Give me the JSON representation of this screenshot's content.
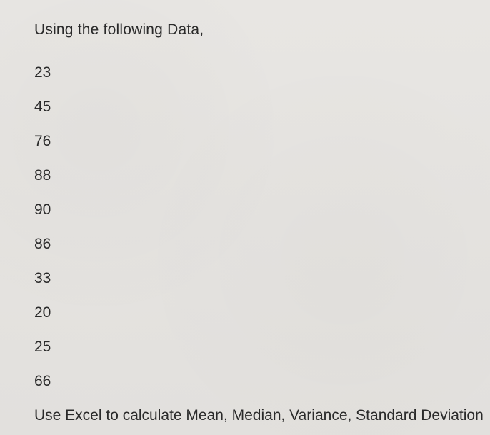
{
  "heading": "Using the following Data,",
  "values": [
    "23",
    "45",
    "76",
    "88",
    "90",
    "86",
    "33",
    "20",
    "25",
    "66"
  ],
  "instruction": "Use Excel to calculate Mean, Median, Variance, Standard Deviation"
}
